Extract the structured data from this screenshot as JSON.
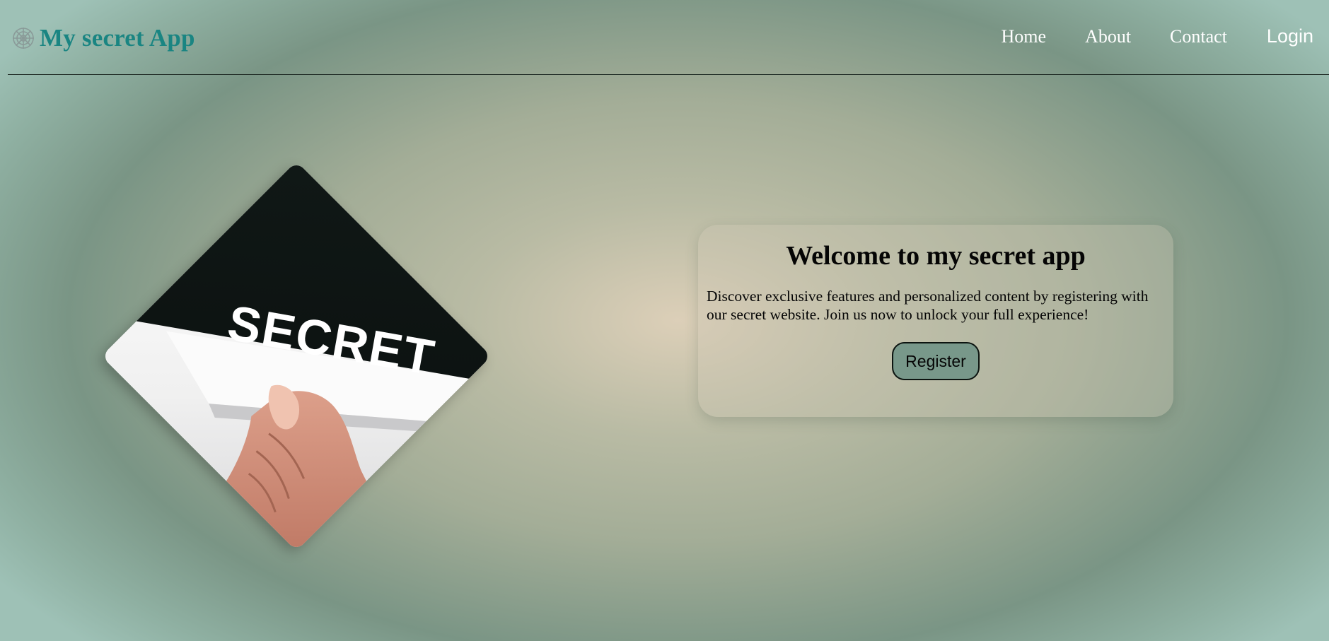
{
  "header": {
    "brand_icon": "web-icon",
    "title": "My secret App",
    "nav": {
      "home": "Home",
      "about": "About",
      "contact": "Contact",
      "login": "Login"
    }
  },
  "hero": {
    "image_label": "SECRET"
  },
  "welcome": {
    "title": "Welcome to my secret app",
    "text": "Discover exclusive features and personalized content by registering with our secret website. Join us now to unlock your full experience!",
    "register_label": "Register"
  },
  "colors": {
    "brand": "#1a8582",
    "nav_text": "#ffffff",
    "button_bg": "#78988a",
    "background_center": "#dccfb8",
    "background_edge": "#7a9585"
  }
}
